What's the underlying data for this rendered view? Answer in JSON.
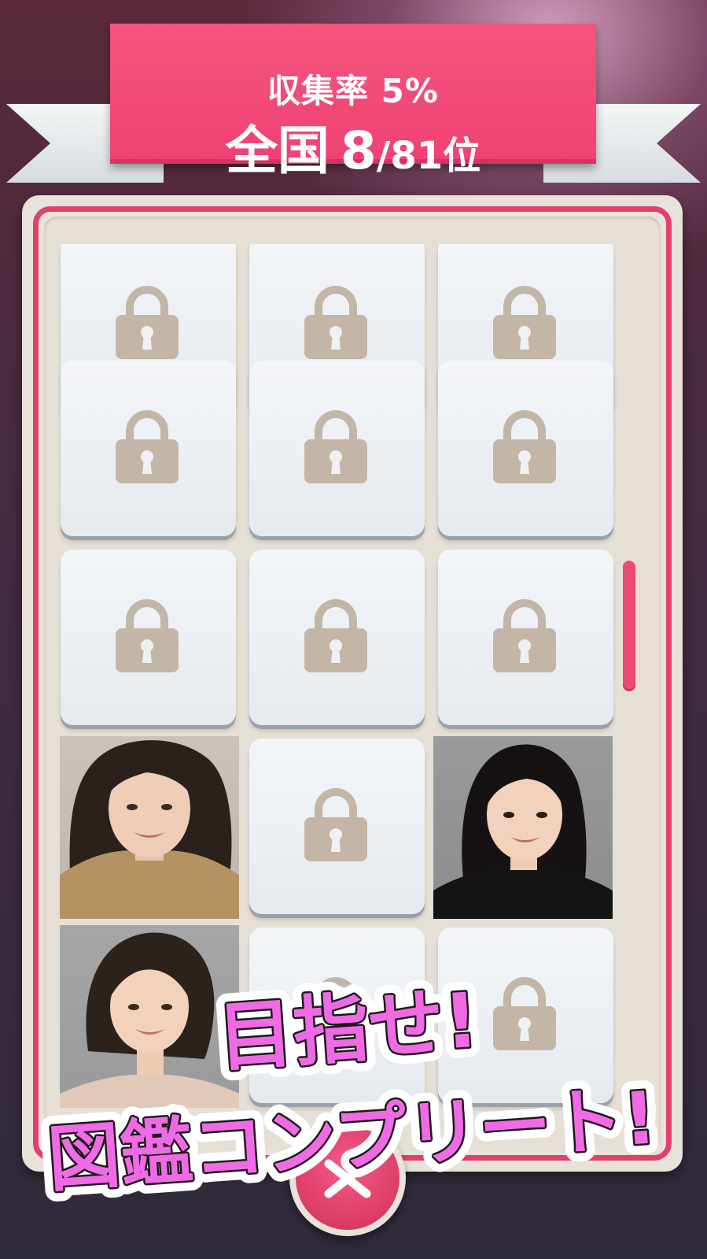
{
  "header": {
    "collection_rate": "収集率 5%",
    "rank_prefix": "全国",
    "rank_value": "8",
    "rank_suffix": "/81位"
  },
  "overlay_text": {
    "line1": "目指せ!",
    "line2": "図鑑コンプリート!"
  },
  "gallery": {
    "cells": [
      {
        "row": 1,
        "col": 1,
        "state": "locked"
      },
      {
        "row": 1,
        "col": 2,
        "state": "locked"
      },
      {
        "row": 1,
        "col": 3,
        "state": "locked"
      },
      {
        "row": 2,
        "col": 1,
        "state": "locked"
      },
      {
        "row": 2,
        "col": 2,
        "state": "locked"
      },
      {
        "row": 2,
        "col": 3,
        "state": "locked"
      },
      {
        "row": 3,
        "col": 1,
        "state": "locked"
      },
      {
        "row": 3,
        "col": 2,
        "state": "locked"
      },
      {
        "row": 3,
        "col": 3,
        "state": "locked"
      },
      {
        "row": 4,
        "col": 1,
        "state": "unlocked"
      },
      {
        "row": 4,
        "col": 2,
        "state": "locked"
      },
      {
        "row": 4,
        "col": 3,
        "state": "unlocked"
      },
      {
        "row": 5,
        "col": 1,
        "state": "unlocked"
      },
      {
        "row": 5,
        "col": 2,
        "state": "locked"
      },
      {
        "row": 5,
        "col": 3,
        "state": "locked"
      }
    ]
  },
  "icons": {
    "lock": "lock-icon",
    "close": "close-icon"
  },
  "colors": {
    "accent_pink": "#ee4274",
    "overlay_text_fill": "#f06ae6",
    "lock_color": "#c4b6a6",
    "tile_bg": "#eef1f4"
  }
}
